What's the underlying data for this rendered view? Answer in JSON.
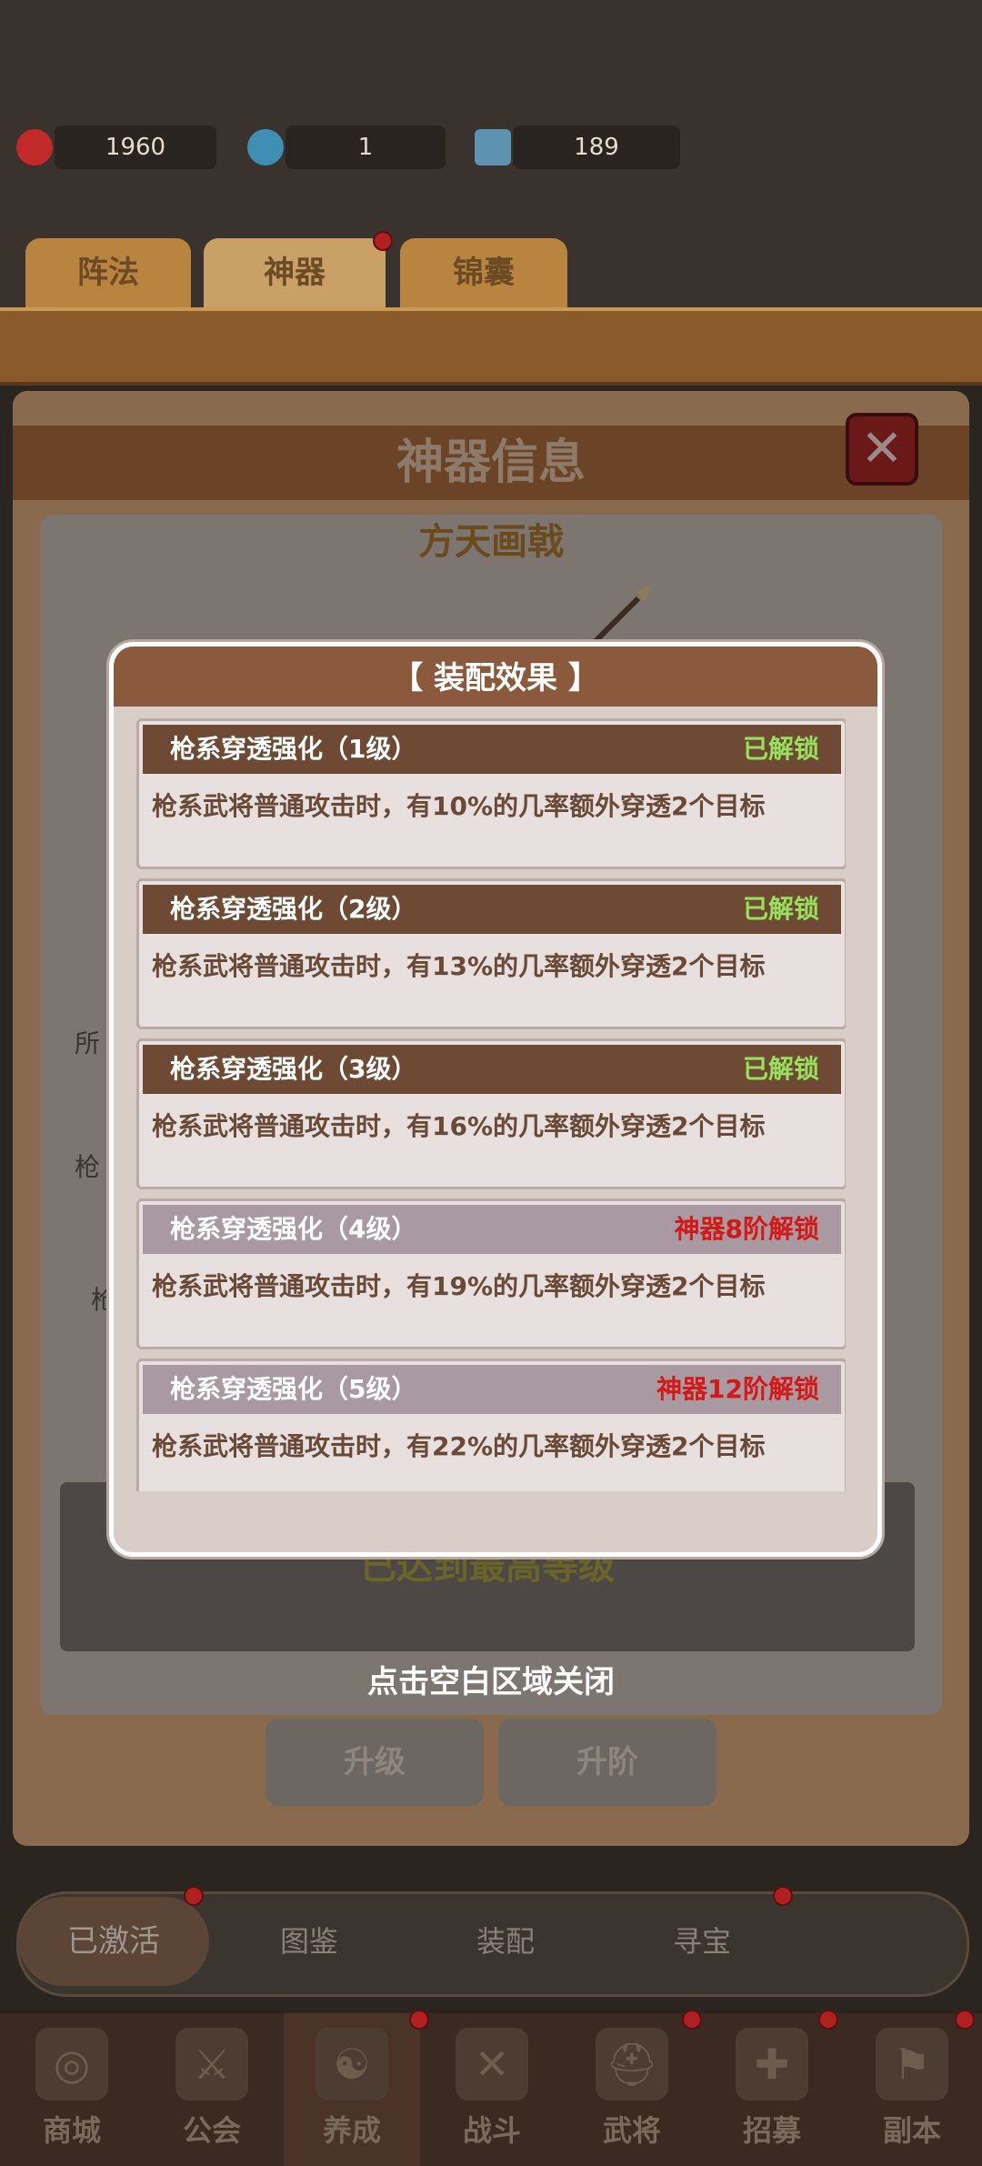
{
  "resources": [
    {
      "icon": "red-gem-icon",
      "value": "1960"
    },
    {
      "icon": "blue-orb-icon",
      "value": "1"
    },
    {
      "icon": "hammer-icon",
      "value": "189"
    }
  ],
  "top_tabs": [
    "阵法",
    "神器",
    "锦囊"
  ],
  "panel": {
    "title": "神器信息",
    "artifact_name": "方天画戟",
    "max_level_text": "已达到最高等级",
    "upgrade_button": "升级",
    "advance_button": "升阶",
    "side_labels": [
      "所",
      "枪",
      "枪"
    ]
  },
  "subnav": {
    "items": [
      "已激活",
      "图鉴",
      "装配",
      "寻宝"
    ]
  },
  "bottom_nav": [
    {
      "label": "商城",
      "icon": "shop-icon"
    },
    {
      "label": "公会",
      "icon": "guild-icon"
    },
    {
      "label": "养成",
      "icon": "cultivate-icon"
    },
    {
      "label": "战斗",
      "icon": "battle-icon"
    },
    {
      "label": "武将",
      "icon": "general-icon"
    },
    {
      "label": "招募",
      "icon": "recruit-icon"
    },
    {
      "label": "副本",
      "icon": "dungeon-icon"
    }
  ],
  "modal": {
    "title": "【 装配效果 】",
    "close_hint": "点击空白区域关闭",
    "effects": [
      {
        "title": "枪系穿透强化（1级）",
        "status": "已解锁",
        "locked": false,
        "desc": "枪系武将普通攻击时，有10%的几率额外穿透2个目标"
      },
      {
        "title": "枪系穿透强化（2级）",
        "status": "已解锁",
        "locked": false,
        "desc": "枪系武将普通攻击时，有13%的几率额外穿透2个目标"
      },
      {
        "title": "枪系穿透强化（3级）",
        "status": "已解锁",
        "locked": false,
        "desc": "枪系武将普通攻击时，有16%的几率额外穿透2个目标"
      },
      {
        "title": "枪系穿透强化（4级）",
        "status": "神器8阶解锁",
        "locked": true,
        "desc": "枪系武将普通攻击时，有19%的几率额外穿透2个目标"
      },
      {
        "title": "枪系穿透强化（5级）",
        "status": "神器12阶解锁",
        "locked": true,
        "desc": "枪系武将普通攻击时，有22%的几率额外穿透2个目标"
      }
    ]
  }
}
